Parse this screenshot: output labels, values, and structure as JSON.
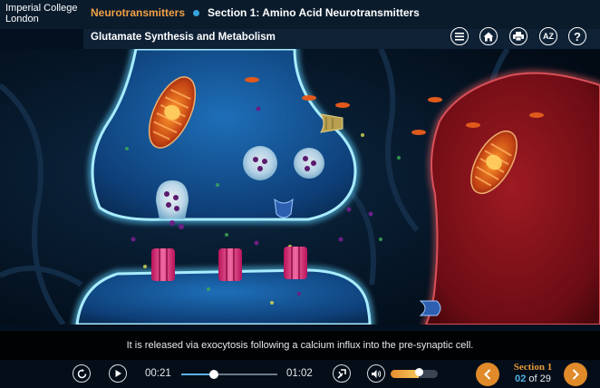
{
  "header": {
    "logo_line1": "Imperial College",
    "logo_line2": "London",
    "course": "Neurotransmitters",
    "section": "Section 1: Amino Acid Neurotransmitters",
    "page_title": "Glutamate Synthesis and Metabolism",
    "glossary_label": "AZ",
    "help_label": "?",
    "icons": [
      "menu-icon",
      "home-icon",
      "print-icon",
      "glossary-icon",
      "help-icon"
    ]
  },
  "caption": "It is released via exocytosis following a calcium influx into the pre-synaptic cell.",
  "player": {
    "current_time": "00:21",
    "total_time": "01:02",
    "progress": 0.34,
    "volume": 0.6,
    "section_label": "Section 1",
    "page_current": "02",
    "page_of": "of 29",
    "icons": [
      "replay-icon",
      "play-icon",
      "interaction-icon",
      "volume-icon",
      "prev-arrow-icon",
      "next-arrow-icon"
    ]
  },
  "colors": {
    "accent_orange": "#e08a2a",
    "accent_blue": "#34a4dc",
    "header_bg": "#0a1b2c",
    "neuron_glow": "#5fd0ff",
    "astrocyte_red": "#a01a22"
  }
}
